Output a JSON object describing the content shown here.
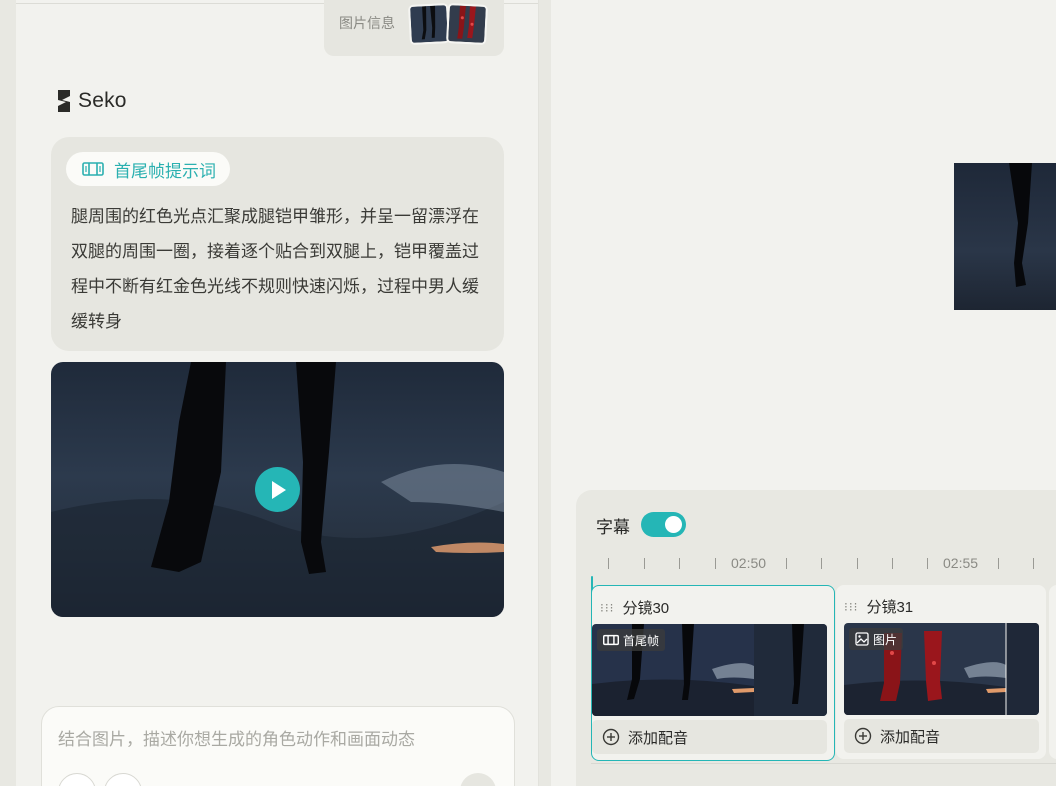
{
  "chat": {
    "image_info_label": "图片信息",
    "logo_text": "Seko",
    "prompt_tag": "首尾帧提示词",
    "prompt_text": "腿周围的红色光点汇聚成腿铠甲雏形，并呈一留漂浮在双腿的周围一圈，接着逐个贴合到双腿上，铠甲覆盖过程中不断有红金色光线不规则快速闪烁，过程中男人缓缓转身",
    "input_placeholder": "结合图片，描述你想生成的角色动作和画面动态"
  },
  "timeline": {
    "subtitle_label": "字幕",
    "subtitle_toggle_on": true,
    "time_labels": [
      "02:50",
      "02:55"
    ],
    "shots": [
      {
        "title": "分镜30",
        "badge": "首尾帧",
        "dub_label": "添加配音",
        "active": true
      },
      {
        "title": "分镜31",
        "badge": "图片",
        "dub_label": "添加配音",
        "active": false
      }
    ]
  },
  "colors": {
    "accent": "#25b6b6",
    "panel_bg": "#f2f2ee",
    "card_bg": "#e6e6e0"
  },
  "icons": [
    "logo-icon",
    "first-last-frame-icon",
    "play-icon",
    "image-icon",
    "plus-circle-icon",
    "drag-grip-icon"
  ]
}
